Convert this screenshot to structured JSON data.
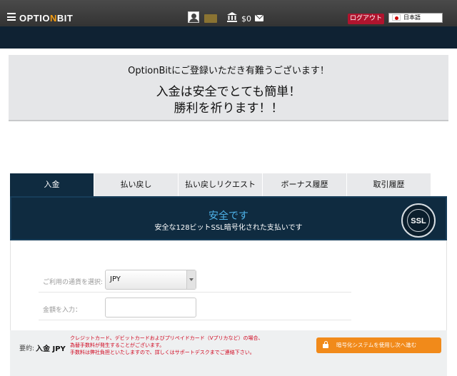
{
  "header": {
    "logo_prefix": "OPTIO",
    "logo_n": "N",
    "logo_suffix": "BIT",
    "balance": "$0",
    "logout_label": "ログアウト",
    "language": "日本語",
    "icons": [
      "menu-icon",
      "avatar-icon",
      "folder-icon",
      "bank-icon",
      "mail-icon",
      "flag-jp-icon"
    ]
  },
  "welcome": {
    "line1": "OptionBitにご登録いただき有難うございます！",
    "line2": "入金は安全でとても簡単！",
    "line3": "勝利を祈ります！！"
  },
  "tabs": [
    {
      "label": "入金"
    },
    {
      "label": "払い戻し"
    },
    {
      "label": "払い戻しリクエスト"
    },
    {
      "label": "ボーナス履歴"
    },
    {
      "label": "取引履歴"
    }
  ],
  "security": {
    "title": "安全です",
    "subtitle": "安全な128ビットSSL暗号化された支払いです",
    "badge": "SSL"
  },
  "form": {
    "currency_label": "ご利用の通貨を選択:",
    "currency_value": "JPY",
    "amount_label": "金額を入力："
  },
  "summary": {
    "label": "要約:",
    "value": "入金 JPY",
    "notes": [
      "クレジットカード、デビットカードおよびプリペイドカード（Vプリカなど）の場合、",
      "為替手数料が発生することがございます。",
      "手数料は弊社負担といたしますので、詳しくはサポートデスクまでご連絡下さい。"
    ],
    "cta_label": "暗号化システムを使用し次へ進む"
  },
  "colors": {
    "nav": "#0f2b40",
    "accent_blue": "#4fb3ea",
    "logout": "#b0142e",
    "cta": "#f18a1a",
    "notes": "#d0021b"
  }
}
